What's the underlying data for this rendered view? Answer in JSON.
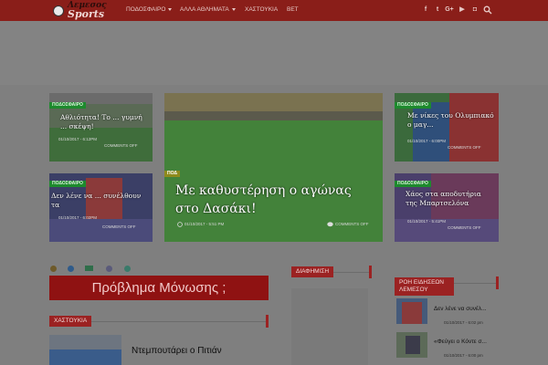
{
  "header": {
    "logo_line1": "Λεμεσος",
    "logo_line2": "Sports",
    "nav": [
      {
        "label": "ΠΟΔΟΣΦΑΙΡΟ",
        "dropdown": true
      },
      {
        "label": "ΑΛΛΑ ΑΘΛΗΜΑΤΑ",
        "dropdown": true
      },
      {
        "label": "ΧΑΣΤΟΥΚΙΑ",
        "dropdown": false
      },
      {
        "label": "ΒΕΤ",
        "dropdown": false
      }
    ],
    "social_icons": [
      {
        "name": "facebook-icon",
        "glyph": "f"
      },
      {
        "name": "twitter-icon",
        "glyph": "t"
      },
      {
        "name": "google-plus-icon",
        "glyph": "G+"
      },
      {
        "name": "youtube-icon",
        "glyph": "▶"
      },
      {
        "name": "instagram-icon",
        "glyph": "◘"
      }
    ],
    "search_icon": "search-icon"
  },
  "cards": {
    "top_left": {
      "badge": "ΠΟΔΟΣΦΑΙΡΟ",
      "title": "Αθλιότητα! Το ... γυμνή ... σκέψη!",
      "date": "01/10/2017 - 6:12PM",
      "comments": "COMMENTS OFF"
    },
    "bottom_left": {
      "badge": "ΠΟΔΟΣΦΑΙΡΟ",
      "title": "Δεν λένε να ... συνέλθουν τα",
      "date": "01/10/2017 - 6:02PM",
      "comments": "COMMENTS OFF"
    },
    "center": {
      "badge": "ΠΟΔ",
      "title": "Με καθυστέρηση ο αγώνας στο Δασάκι!",
      "date": "01/10/2017 - 5:51 PM",
      "comments": "COMMENTS OFF"
    },
    "top_right": {
      "badge": "ΠΟΔΟΣΦΑΙΡΟ",
      "title": "Με νίκες του Ολυμπιακό ο μαγ...",
      "date": "01/10/2017 - 6:00PM",
      "comments": "COMMENTS OFF"
    },
    "bottom_right": {
      "badge": "ΠΟΔΟΣΦΑΙΡΟ",
      "title": "Χάος στα αποδυτήρια της Μπαρτσελόνα",
      "date": "01/10/2017 - 5:41PM",
      "comments": "COMMENTS OFF"
    }
  },
  "promo": {
    "text": "Πρόβλημα Μόνωσης ;"
  },
  "sections": {
    "hastoukia": "ΧΑΣΤΟΥΚΙΑ",
    "advert": "ΔΙΑΦΗΜΙΣΗ",
    "news_feed": "ΡΟΗ ΕΙΔΗΣΕΩΝ ΛΕΜΕΣΟΥ"
  },
  "article": {
    "title": "Ντεμπουτάρει ο Πιτιάν"
  },
  "news_feed": [
    {
      "title": "Δεν λένε να συνέλ...",
      "date": "01/10/2017 - 6:02 pm"
    },
    {
      "title": "«Φεύγει ο Κόντε σ...",
      "date": "01/10/2017 - 6:00 pm"
    }
  ],
  "colors": {
    "topbar": "#8a1e19",
    "accent_red": "#9b2222",
    "badge_green": "#1d8a2d",
    "overlay_dim": "#7f7f7f"
  }
}
